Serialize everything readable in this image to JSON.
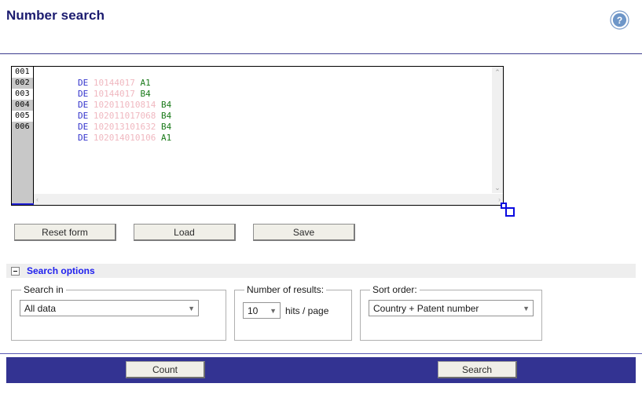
{
  "header": {
    "title": "Number search",
    "help_icon": "help-question-icon"
  },
  "editor": {
    "line_numbers": [
      "001",
      "002",
      "003",
      "004",
      "005",
      "006"
    ],
    "lines": [
      {
        "country": "DE",
        "number": "10144017",
        "kind": "A1"
      },
      {
        "country": "DE",
        "number": "10144017",
        "kind": "B4"
      },
      {
        "country": "DE",
        "number": "102011010814",
        "kind": "B4"
      },
      {
        "country": "DE",
        "number": "102011017068",
        "kind": "B4"
      },
      {
        "country": "DE",
        "number": "102013101632",
        "kind": "B4"
      },
      {
        "country": "DE",
        "number": "102014010106",
        "kind": "A1"
      }
    ],
    "scroll": {
      "up_arrow": "⌃",
      "down_arrow": "⌄",
      "left_arrow": "‹",
      "right_arrow": "›"
    },
    "colors": {
      "country": "#3333cc",
      "number": "#f0b8c0",
      "kind": "#1a7a1a",
      "gutter": "#c8c8c8"
    }
  },
  "toolbar": {
    "reset_label": "Reset form",
    "load_label": "Load",
    "save_label": "Save"
  },
  "search_options": {
    "section_label": "Search options",
    "collapsed": false,
    "search_in": {
      "legend": "Search in",
      "value": "All data",
      "options": [
        "All data"
      ]
    },
    "number_of_results": {
      "legend": "Number of results:",
      "value": "10",
      "options": [
        "10"
      ],
      "suffix": "hits / page"
    },
    "sort_order": {
      "legend": "Sort order:",
      "value": "Country + Patent number",
      "options": [
        "Country + Patent number"
      ]
    }
  },
  "footer": {
    "count_label": "Count",
    "search_label": "Search",
    "bar_color": "#333392"
  }
}
